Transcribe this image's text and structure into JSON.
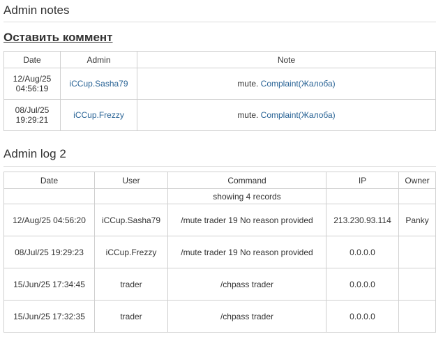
{
  "admin_notes": {
    "title": "Admin notes",
    "leave_comment_link": "Оставить коммент",
    "columns": [
      "Date",
      "Admin",
      "Note"
    ],
    "rows": [
      {
        "date_line1": "12/Aug/25",
        "date_line2": "04:56:19",
        "admin": "iCCup.Sasha79",
        "note_text": "mute.",
        "note_link": "Complaint(Жалоба)"
      },
      {
        "date_line1": "08/Jul/25",
        "date_line2": "19:29:21",
        "admin": "iCCup.Frezzy",
        "note_text": "mute.",
        "note_link": "Complaint(Жалоба)"
      }
    ]
  },
  "admin_log": {
    "title": "Admin log 2",
    "columns": [
      "Date",
      "User",
      "Command",
      "IP",
      "Owner"
    ],
    "records_info": "showing 4 records",
    "rows": [
      {
        "date": "12/Aug/25 04:56:20",
        "user": "iCCup.Sasha79",
        "command": "/mute trader 19 No reason provided",
        "ip": "213.230.93.114",
        "owner": "Panky"
      },
      {
        "date": "08/Jul/25 19:29:23",
        "user": "iCCup.Frezzy",
        "command": "/mute trader 19 No reason provided",
        "ip": "0.0.0.0",
        "owner": ""
      },
      {
        "date": "15/Jun/25 17:34:45",
        "user": "trader",
        "command": "/chpass trader",
        "ip": "0.0.0.0",
        "owner": ""
      },
      {
        "date": "15/Jun/25 17:32:35",
        "user": "trader",
        "command": "/chpass trader",
        "ip": "0.0.0.0",
        "owner": ""
      }
    ]
  }
}
